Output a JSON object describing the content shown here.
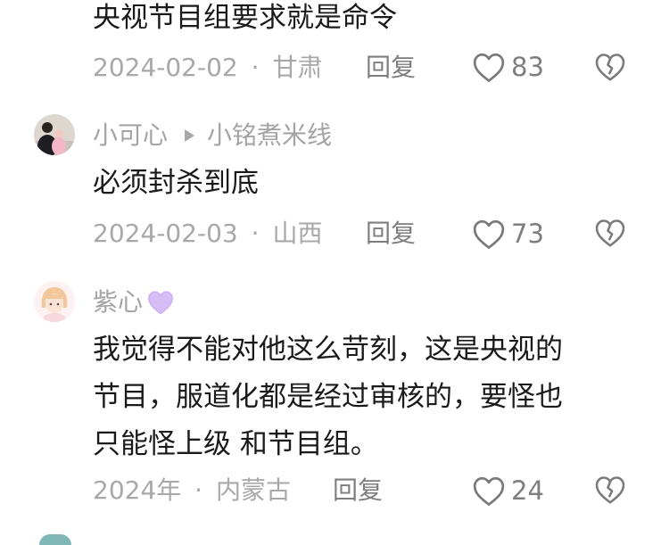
{
  "comments": [
    {
      "text_lines": [
        "央视节目组要求就是命令"
      ],
      "date": "2024-02-02",
      "location": "甘肃",
      "reply_label": "回复",
      "likes": "83"
    },
    {
      "author": "小可心",
      "reply_to": "小铭煮米线",
      "text_lines": [
        "必须封杀到底"
      ],
      "date": "2024-02-03",
      "location": "山西",
      "reply_label": "回复",
      "likes": "73"
    },
    {
      "author": "紫心",
      "text_lines": [
        "我觉得不能对他这么苛刻，这是央视的",
        "节目，服道化都是经过审核的，要怪也",
        "只能怪上级 和节目组。"
      ],
      "date": "2024年",
      "location": "内蒙古",
      "reply_label": "回复",
      "likes": "24"
    }
  ],
  "separator": "·",
  "colors": {
    "text": "#1a1a1a",
    "meta": "#a8a8a8",
    "accent_heart": "#cfb3f2"
  },
  "icons": [
    "heart-outline-icon",
    "broken-heart-icon",
    "purple-heart-emoji",
    "reply-arrow-icon"
  ]
}
